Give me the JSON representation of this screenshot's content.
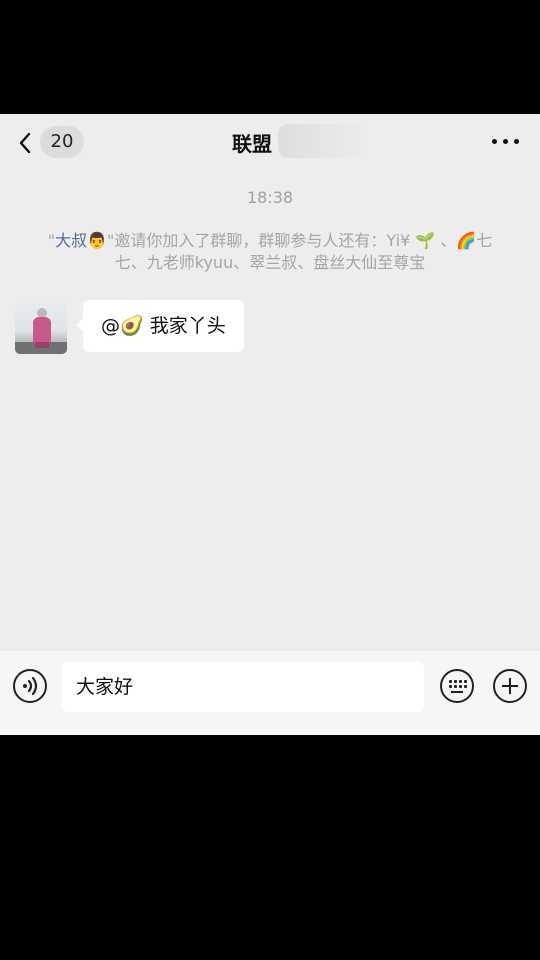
{
  "nav": {
    "back_count": "20",
    "title": "联盟"
  },
  "chat": {
    "timestamp": "18:38",
    "system": {
      "quote_open": "\"",
      "inviter": "大叔👨",
      "after_inviter": "\"邀请你加入了群聊，群聊参与人还有：Yi¥ 🌱 、🌈七七、九老师kyuu、翠兰叔、盘丝大仙至尊宝"
    },
    "messages": [
      {
        "text": "@🥑 我家丫头"
      }
    ]
  },
  "input": {
    "value": "大家好"
  },
  "colors": {
    "link": "#576b95",
    "chat_bg": "#ededed",
    "bubble": "#ffffff"
  }
}
